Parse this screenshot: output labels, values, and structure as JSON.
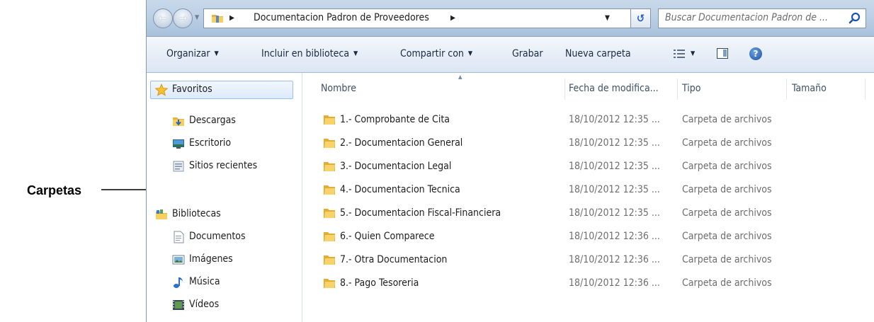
{
  "annotation": {
    "label": "Carpetas"
  },
  "address_bar": {
    "path": "Documentacion Padron de Proveedores",
    "search_placeholder": "Buscar Documentacion Padron de ..."
  },
  "toolbar": {
    "organize": "Organizar",
    "include_library": "Incluir en biblioteca",
    "share_with": "Compartir con",
    "burn": "Grabar",
    "new_folder": "Nueva carpeta"
  },
  "navigation": {
    "favorites": {
      "label": "Favoritos",
      "items": [
        "Descargas",
        "Escritorio",
        "Sitios recientes"
      ]
    },
    "libraries": {
      "label": "Bibliotecas",
      "items": [
        "Documentos",
        "Imágenes",
        "Música",
        "Vídeos"
      ]
    }
  },
  "file_list": {
    "columns": [
      "Nombre",
      "Fecha de modifica...",
      "Tipo",
      "Tamaño"
    ],
    "rows": [
      {
        "name": "1.- Comprobante de Cita",
        "date": "18/10/2012 12:35 ...",
        "type": "Carpeta de archivos"
      },
      {
        "name": "2.- Documentacion General",
        "date": "18/10/2012 12:35 ...",
        "type": "Carpeta de archivos"
      },
      {
        "name": "3.- Documentacion Legal",
        "date": "18/10/2012 12:35 ...",
        "type": "Carpeta de archivos"
      },
      {
        "name": "4.- Documentacion Tecnica",
        "date": "18/10/2012 12:35 ...",
        "type": "Carpeta de archivos"
      },
      {
        "name": "5.- Documentacion Fiscal-Financiera",
        "date": "18/10/2012 12:35 ...",
        "type": "Carpeta de archivos"
      },
      {
        "name": "6.- Quien Comparece",
        "date": "18/10/2012 12:36 ...",
        "type": "Carpeta de archivos"
      },
      {
        "name": "7.- Otra Documentacion",
        "date": "18/10/2012 12:36 ...",
        "type": "Carpeta de archivos"
      },
      {
        "name": "8.- Pago Tesoreria",
        "date": "18/10/2012 12:36 ...",
        "type": "Carpeta de archivos"
      }
    ]
  },
  "icons": {
    "folder": "folder-icon",
    "star": "star-icon",
    "downloads": "downloads-icon",
    "desktop": "desktop-icon",
    "recent": "recent-places-icon",
    "libraries": "libraries-icon",
    "documents": "documents-icon",
    "pictures": "pictures-icon",
    "music": "music-icon",
    "videos": "videos-icon"
  }
}
